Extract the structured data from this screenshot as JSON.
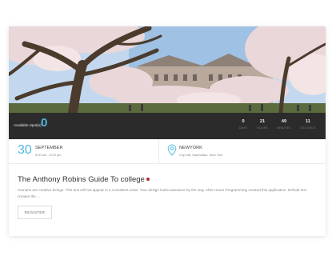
{
  "event": {
    "available_label": "Available Spot(s)",
    "available_value": "0",
    "counts": [
      {
        "value": "0",
        "unit": "DAYS"
      },
      {
        "value": "21",
        "unit": "HOURS"
      },
      {
        "value": "49",
        "unit": "MINUTES"
      },
      {
        "value": "11",
        "unit": "SECONDS"
      }
    ],
    "date": {
      "day": "30",
      "month": "SEPTEMBER",
      "time": "8:00 am - 5:00 pm"
    },
    "location": {
      "city": "NEWYORK",
      "address": "City hall, Manhattan, New York",
      "icon": "map-pin-icon"
    },
    "title": "The Anthony Robins Guide To college",
    "description": "Humans are creative beings. This text will not appear in a consistent order. Your design looks awesome by the way. After Hours Programming created this application. Default text creates the ...",
    "register_label": "REGISTER"
  },
  "colors": {
    "accent": "#4fb8e0",
    "dark_bar": "#2b2b2b",
    "title_dot": "#b02a2a"
  }
}
